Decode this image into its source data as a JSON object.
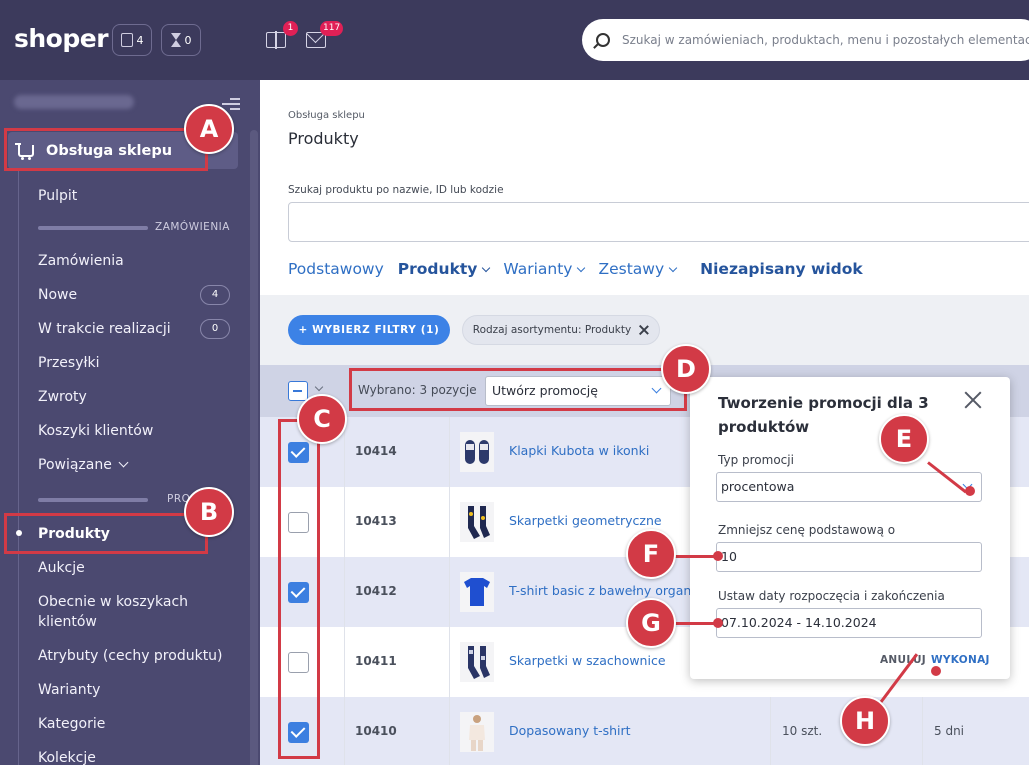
{
  "topbar": {
    "logo": "shoper",
    "chip_docs_count": "4",
    "chip_hourglass_count": "0",
    "gift_badge": "1",
    "mail_badge": "117",
    "search_placeholder": "Szukaj w zamówieniach, produktach, menu i pozostałych elementach"
  },
  "sidebar": {
    "section_title": "Obsługa sklepu",
    "items": [
      {
        "label": "Pulpit"
      },
      {
        "label": "Zamówienia"
      },
      {
        "label": "Nowe",
        "count": "4"
      },
      {
        "label": "W trakcie realizacji",
        "count": "0"
      },
      {
        "label": "Przesyłki"
      },
      {
        "label": "Zwroty"
      },
      {
        "label": "Koszyki klientów"
      },
      {
        "label": "Powiązane"
      },
      {
        "label": "Produkty"
      },
      {
        "label": "Aukcje"
      },
      {
        "label": "Obecnie w koszykach",
        "label2": "klientów"
      },
      {
        "label": "Atrybuty (cechy produktu)"
      },
      {
        "label": "Warianty"
      },
      {
        "label": "Kategorie"
      },
      {
        "label": "Kolekcje"
      }
    ],
    "group_orders": "ZAMÓWIENIA",
    "group_products": "PRO"
  },
  "main": {
    "breadcrumb": "Obsługa sklepu",
    "title": "Produkty",
    "search_label": "Szukaj produktu po nazwie, ID lub kodzie",
    "tabs": [
      "Podstawowy",
      "Produkty",
      "Warianty",
      "Zestawy",
      "Niezapisany widok"
    ],
    "filter_button": "+ WYBIERZ FILTRY (1)",
    "filter_chip": "Rodzaj asortymentu: Produkty",
    "selected_text": "Wybrano: 3 pozycje",
    "bulk_action": "Utwórz promocję",
    "rows": [
      {
        "id": "10414",
        "name": "Klapki Kubota w ikonki",
        "checked": true
      },
      {
        "id": "10413",
        "name": "Skarpetki geometryczne",
        "checked": false
      },
      {
        "id": "10412",
        "name": "T-shirt basic z bawełny organicznej",
        "checked": true
      },
      {
        "id": "10411",
        "name": "Skarpetki w szachownice",
        "checked": false
      },
      {
        "id": "10410",
        "name": "Dopasowany t-shirt",
        "checked": true,
        "qty": "10 szt.",
        "days": "5 dni"
      }
    ]
  },
  "popup": {
    "title": "Tworzenie promocji dla 3 produktów",
    "type_label": "Typ promocji",
    "type_value": "procentowa",
    "reduce_label": "Zmniejsz cenę podstawową o",
    "reduce_value": "10",
    "dates_label": "Ustaw daty rozpoczęcia i zakończenia",
    "dates_value": "07.10.2024 - 14.10.2024",
    "cancel": "ANULUJ",
    "execute": "WYKONAJ"
  },
  "annotations": [
    "A",
    "B",
    "C",
    "D",
    "E",
    "F",
    "G",
    "H"
  ],
  "colors": {
    "topbar": "#3c3a5c",
    "sidebar": "#4b4970",
    "accent_blue": "#3c82e6",
    "annotation_red": "#d23a46"
  }
}
